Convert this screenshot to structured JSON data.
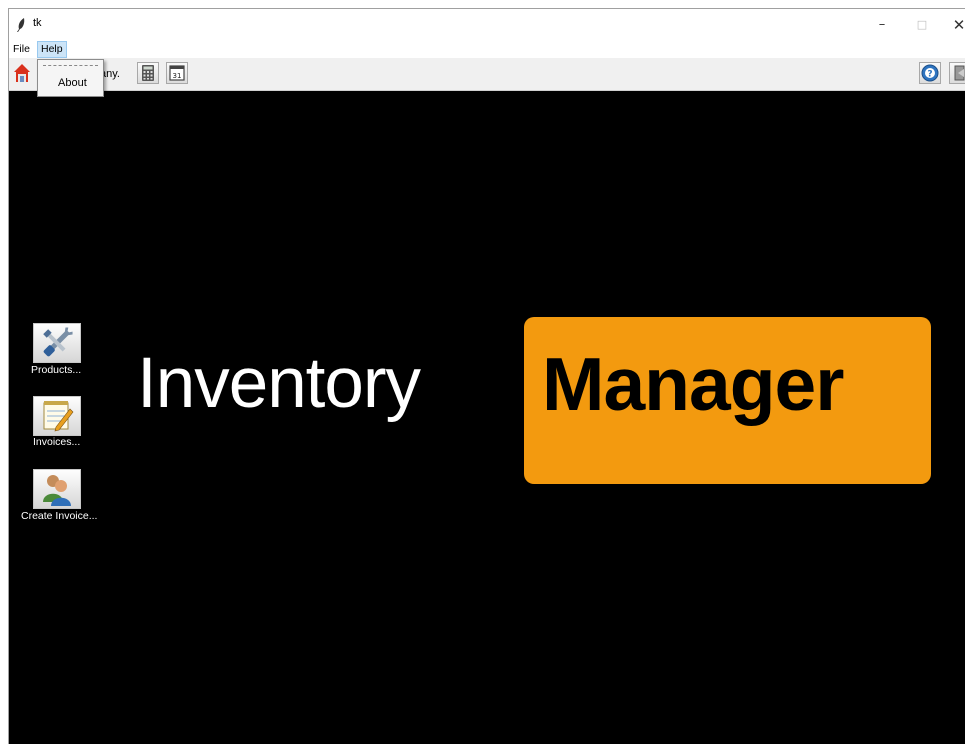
{
  "window": {
    "title": "tk",
    "controls": {
      "minimize": "–",
      "maximize": "□",
      "close": "✕"
    }
  },
  "menubar": {
    "items": [
      "File",
      "Help"
    ]
  },
  "help_menu": {
    "items": [
      "About"
    ]
  },
  "toolbar": {
    "company_text": "any.",
    "buttons": [
      "home-icon",
      "calculator-icon",
      "calendar-icon",
      "help-icon",
      "exit-icon"
    ],
    "calendar_day": "31"
  },
  "sidebar": {
    "items": [
      {
        "label": "Products...",
        "icon": "tools-icon"
      },
      {
        "label": "Invoices...",
        "icon": "notepad-icon"
      },
      {
        "label": "Create Invoice...",
        "icon": "users-icon"
      }
    ]
  },
  "logo": {
    "left_text": "Inventory",
    "right_text": "Manager",
    "accent": "#f39a0f"
  }
}
